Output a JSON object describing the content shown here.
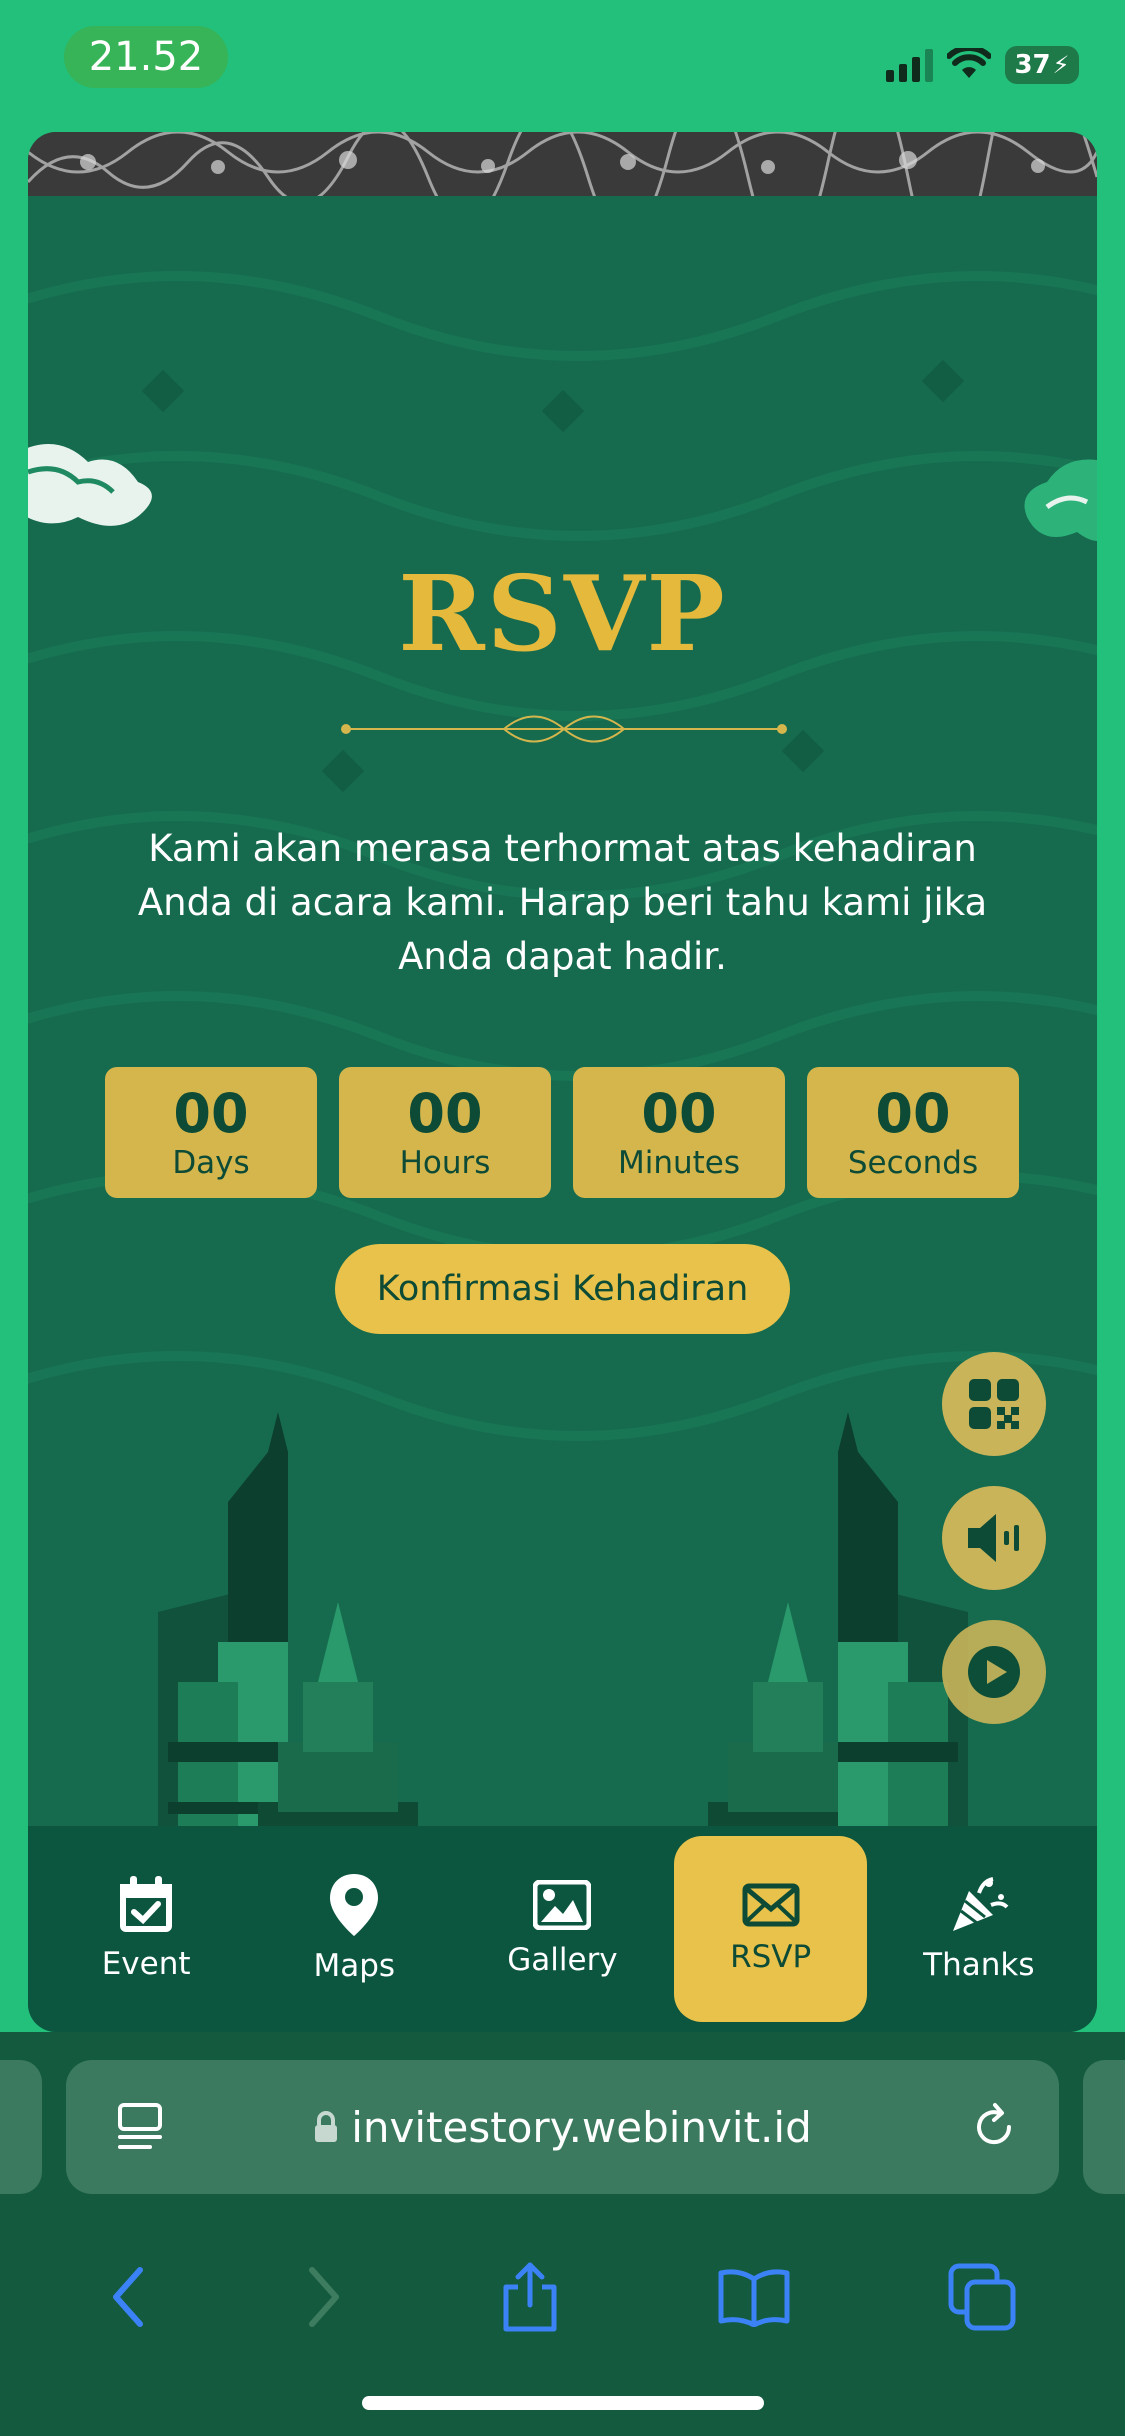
{
  "status": {
    "time": "21.52",
    "battery": "37"
  },
  "rsvp": {
    "title": "RSVP",
    "description": "Kami akan merasa terhormat atas kehadiran Anda di acara kami. Harap beri tahu kami jika Anda dapat hadir.",
    "countdown": [
      {
        "value": "00",
        "label": "Days"
      },
      {
        "value": "00",
        "label": "Hours"
      },
      {
        "value": "00",
        "label": "Minutes"
      },
      {
        "value": "00",
        "label": "Seconds"
      }
    ],
    "confirm_label": "Konfirmasi Kehadiran"
  },
  "fabs": [
    "qr-code-icon",
    "speaker-icon",
    "play-icon"
  ],
  "nav": {
    "items": [
      {
        "label": "Event",
        "icon": "calendar-check-icon"
      },
      {
        "label": "Maps",
        "icon": "map-pin-icon"
      },
      {
        "label": "Gallery",
        "icon": "image-icon"
      },
      {
        "label": "RSVP",
        "icon": "envelope-icon",
        "active": true
      },
      {
        "label": "Thanks",
        "icon": "party-popper-icon"
      }
    ]
  },
  "browser": {
    "url": "invitestory.webinvit.id"
  },
  "colors": {
    "accent": "#e8c24a",
    "card_bg": "#166b4e",
    "page_bg": "#22c07a",
    "nav_bg": "#0c5640",
    "safari_blue": "#3b82f6"
  }
}
